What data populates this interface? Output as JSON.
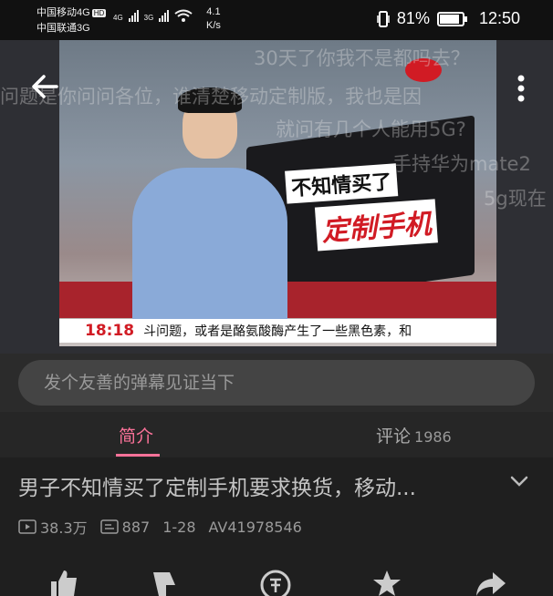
{
  "status_bar": {
    "carrier1": "中国移动4G",
    "hd_badge": "HD",
    "carrier2": "中国联通3G",
    "net1": "4G",
    "net2": "3G",
    "speed_value": "4.1",
    "speed_unit": "K/s",
    "battery": "81%",
    "time": "12:50"
  },
  "video": {
    "headline_line1": "不知情买了",
    "headline_line2": "定制手机",
    "ticker_time": "18:18",
    "ticker_text": "斗问题，或者是酪氨酸酶产生了一些黑色素，和",
    "danmaku": [
      "30天了你我不是都吗去？",
      "问题是你问问各位，谁清楚移动定制版，我也是因",
      "就问有几个人能用5G?",
      "手持华为mate2",
      "5g现在"
    ]
  },
  "danmu_input": {
    "placeholder": "发个友善的弹幕见证当下"
  },
  "tabs": {
    "intro": "简介",
    "comments": "评论",
    "comments_count": "1986"
  },
  "detail": {
    "title": "男子不知情买了定制手机要求换货，移动...",
    "views": "38.3万",
    "danmaku_count": "887",
    "date": "1-28",
    "av": "AV41978546"
  },
  "colors": {
    "accent": "#fb7299",
    "background": "#1f1f1f"
  },
  "icons": [
    "back-arrow-icon",
    "more-vertical-icon",
    "play-count-icon",
    "danmaku-count-icon",
    "chevron-down-icon",
    "like-icon",
    "dislike-icon",
    "coin-icon",
    "star-icon",
    "share-icon"
  ]
}
